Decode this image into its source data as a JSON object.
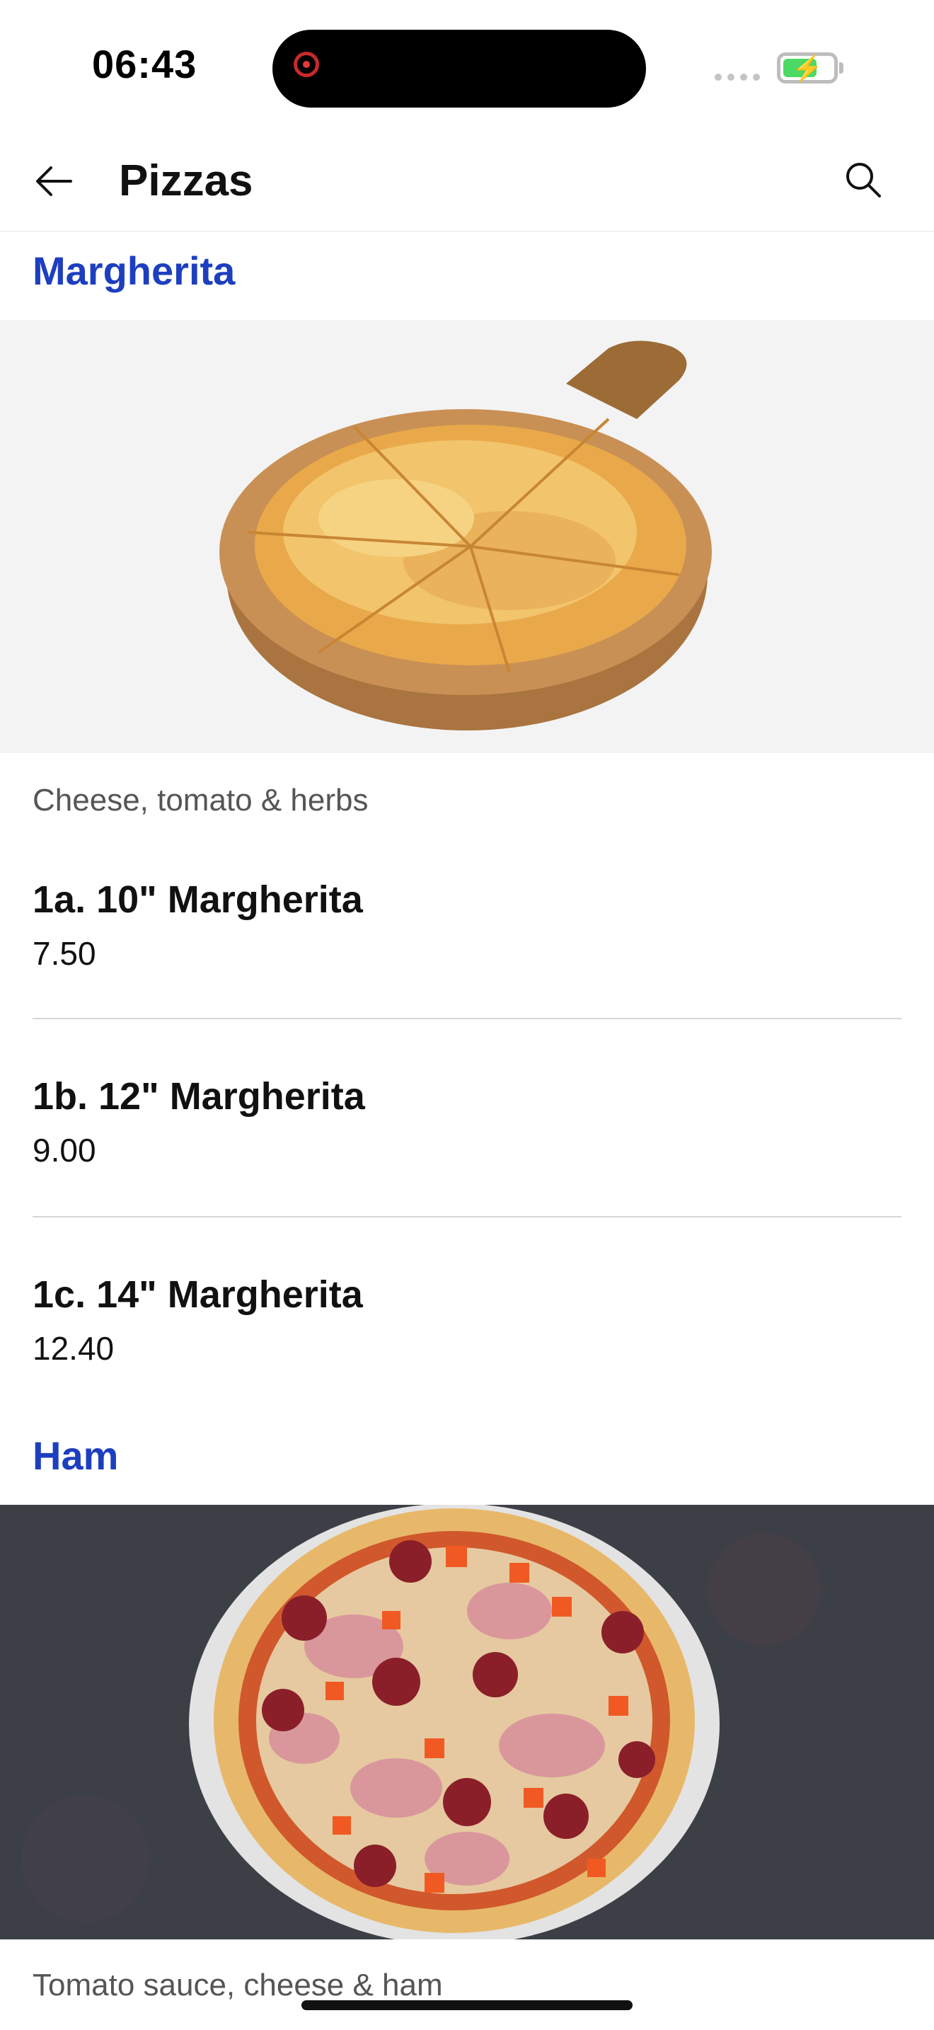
{
  "status": {
    "time": "06:43"
  },
  "header": {
    "title": "Pizzas"
  },
  "sections": [
    {
      "title": "Margherita",
      "description": "Cheese, tomato & herbs",
      "items": [
        {
          "name": "1a. 10\" Margherita",
          "price": "7.50"
        },
        {
          "name": "1b. 12\" Margherita",
          "price": "9.00"
        },
        {
          "name": "1c. 14\" Margherita",
          "price": "12.40"
        }
      ]
    },
    {
      "title": "Ham",
      "description": "Tomato sauce, cheese & ham"
    }
  ],
  "colors": {
    "section_title": "#1d3fbf",
    "battery": "#4cd964",
    "record": "#c8292b"
  }
}
